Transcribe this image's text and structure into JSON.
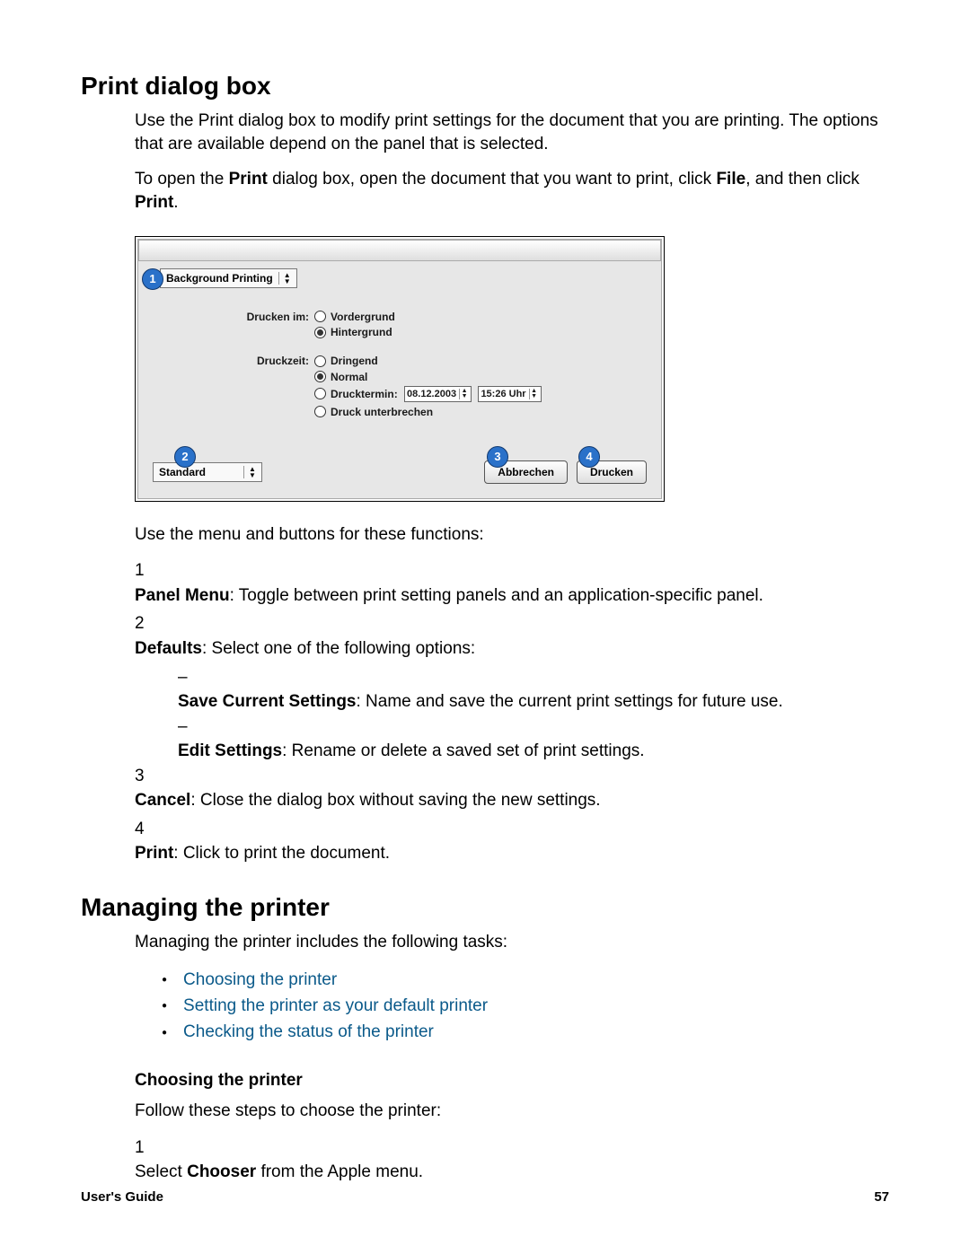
{
  "headings": {
    "h1": "Print dialog box",
    "h2": "Managing the printer",
    "h3": "Choosing the printer"
  },
  "intro": {
    "p1a": "Use the Print dialog box to modify print settings for the document that you are printing. The options that are available depend on the panel that is selected.",
    "p2_pre": "To open the ",
    "p2_b1": "Print",
    "p2_mid1": " dialog box, open the document that you want to print, click ",
    "p2_b2": "File",
    "p2_mid2": ", and then click ",
    "p2_b3": "Print",
    "p2_end": "."
  },
  "dialog": {
    "panel_menu": "Background Printing",
    "label_drucken": "Drucken im:",
    "opt_vordergrund": "Vordergrund",
    "opt_hintergrund": "Hintergrund",
    "label_druckzeit": "Druckzeit:",
    "opt_dringend": "Dringend",
    "opt_normal": "Normal",
    "opt_drucktermin": "Drucktermin:",
    "date_value": "08.12.2003",
    "time_value": "15:26 Uhr",
    "opt_unterbrechen": "Druck unterbrechen",
    "defaults_menu": "Standard",
    "btn_cancel": "Abbrechen",
    "btn_print": "Drucken",
    "callouts": {
      "c1": "1",
      "c2": "2",
      "c3": "3",
      "c4": "4"
    }
  },
  "after_dialog": "Use the menu and buttons for these functions:",
  "list": {
    "n1": "1",
    "i1_b": "Panel Menu",
    "i1_t": ": Toggle between print setting panels and an application-specific panel.",
    "n2": "2",
    "i2_b": "Defaults",
    "i2_t": ": Select one of the following options:",
    "d1_b": "Save Current Settings",
    "d1_t": ": Name and save the current print settings for future use.",
    "d2_b": "Edit Settings",
    "d2_t": ": Rename or delete a saved set of print settings.",
    "n3": "3",
    "i3_b": "Cancel",
    "i3_t": ": Close the dialog box without saving the new settings.",
    "n4": "4",
    "i4_b": "Print",
    "i4_t": ": Click to print the document."
  },
  "managing": {
    "intro": "Managing the printer includes the following tasks:",
    "links": {
      "l1": "Choosing the printer",
      "l2": "Setting the printer as your default printer",
      "l3": "Checking the status of the printer"
    }
  },
  "choosing": {
    "intro": "Follow these steps to choose the printer:",
    "n1": "1",
    "s1_pre": "Select ",
    "s1_b": "Chooser",
    "s1_post": " from the Apple menu."
  },
  "footer": {
    "left": "User's Guide",
    "right": "57"
  }
}
